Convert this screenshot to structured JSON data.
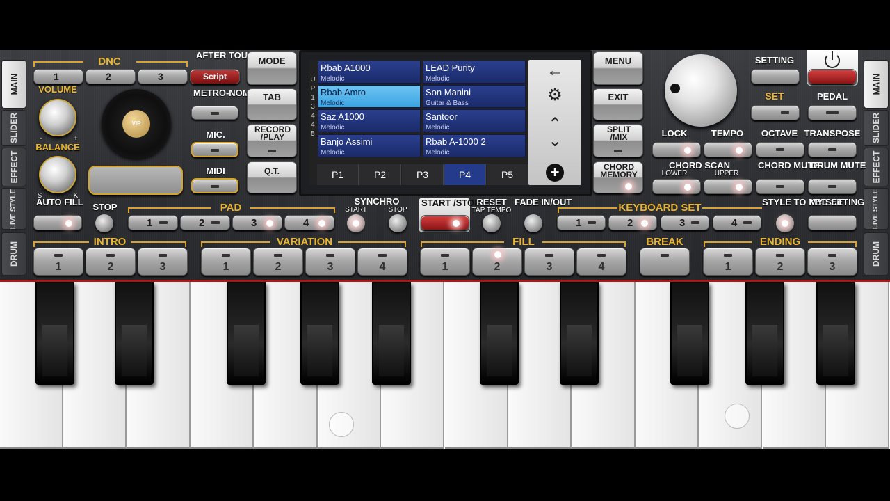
{
  "side_tabs": {
    "left": [
      "MAIN",
      "SLIDER",
      "EFFECT",
      "LIVE STYLE",
      "DRUM"
    ],
    "right": [
      "MAIN",
      "SLIDER",
      "EFFECT",
      "LIVE STYLE",
      "DRUM"
    ]
  },
  "dnc": {
    "label": "DNC",
    "buttons": [
      "1",
      "2",
      "3"
    ],
    "script": "Script"
  },
  "labels": {
    "after_touch": "AFTER TOUCH",
    "metronome": "METRO-NOME",
    "mic": "MIC.",
    "midi": "MIDI",
    "volume": "VOLUME",
    "balance": "BALANCE",
    "bal_minus": "-",
    "bal_plus": "+",
    "bal_s": "S",
    "bal_k": "K",
    "mode": "MODE",
    "tab": "TAB",
    "record_play": "RECORD /PLAY",
    "qt": "Q.T.",
    "menu": "MENU",
    "exit": "EXIT",
    "split_mix": "SPLIT /MIX",
    "chord_memory": "CHORD MEMORY",
    "setting": "SETTING",
    "set": "SET",
    "pedal": "PEDAL",
    "lock": "LOCK",
    "tempo": "TEMPO",
    "octave": "OCTAVE",
    "transpose": "TRANSPOSE",
    "chord_scan": "CHORD SCAN",
    "lower": "LOWER",
    "upper": "UPPER",
    "chord_mute": "CHORD MUTE",
    "drum_mute": "DRUM MUTE",
    "auto_fill": "AUTO FILL",
    "stop": "STOP",
    "pad": "PAD",
    "synchro": "SYNCHRO",
    "start": "START",
    "sstop": "STOP",
    "start_stop": "START /STOP",
    "reset": "RESET",
    "tap_tempo": "TAP TEMPO",
    "fade": "FADE IN/OUT",
    "keyboard_set": "KEYBOARD SET",
    "style_to_kbd": "STYLE TO KBD SET",
    "my_setting": "MY SETTING",
    "intro": "INTRO",
    "variation": "VARIATION",
    "fill": "FILL",
    "break": "BREAK",
    "ending": "ENDING",
    "vip": "VIP"
  },
  "pad_buttons": [
    "1",
    "2",
    "3",
    "4"
  ],
  "kbd_set_buttons": [
    "1",
    "2",
    "3",
    "4"
  ],
  "intro_buttons": [
    "1",
    "2",
    "3"
  ],
  "variation_buttons": [
    "1",
    "2",
    "3",
    "4"
  ],
  "fill_buttons": [
    "1",
    "2",
    "3",
    "4"
  ],
  "ending_buttons": [
    "1",
    "2",
    "3"
  ],
  "screen": {
    "side_letters": [
      "U",
      "P",
      "1",
      "3",
      "4",
      "4",
      "5"
    ],
    "voices": [
      {
        "name": "Rbab A1000",
        "cat": "Melodic"
      },
      {
        "name": "LEAD Purity",
        "cat": "Melodic"
      },
      {
        "name": "Rbab Amro",
        "cat": "Melodic",
        "selected": true
      },
      {
        "name": "Son Manini",
        "cat": "Guitar & Bass"
      },
      {
        "name": "Saz A1000",
        "cat": "Melodic"
      },
      {
        "name": "Santoor",
        "cat": "Melodic"
      },
      {
        "name": "Banjo Assimi",
        "cat": "Melodic"
      },
      {
        "name": "Rbab A-1000 2",
        "cat": "Melodic"
      }
    ],
    "pages": [
      "P1",
      "P2",
      "P3",
      "P4",
      "P5"
    ],
    "active_page": "P4",
    "nav": {
      "back": "←",
      "settings": "⚙",
      "up": "⌃",
      "down": "⌄",
      "add": "+"
    }
  },
  "colors": {
    "accent": "#e9b530",
    "selected_cell": "#5ab8ee",
    "active_page": "#243a8a",
    "red": "#b02020"
  }
}
